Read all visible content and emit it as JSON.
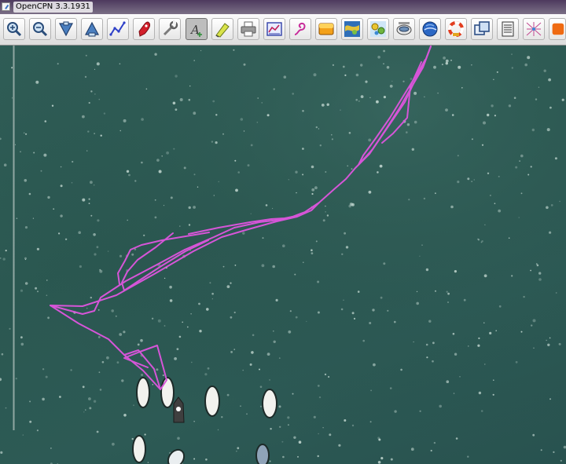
{
  "window": {
    "title": "OpenCPN 3.3.1931"
  },
  "toolbar": {
    "tools": [
      {
        "name": "zoom-in-icon"
      },
      {
        "name": "zoom-out-icon"
      },
      {
        "name": "scale-down-icon"
      },
      {
        "name": "scale-up-icon"
      },
      {
        "name": "create-route-icon"
      },
      {
        "name": "auto-follow-icon"
      },
      {
        "name": "settings-icon"
      },
      {
        "name": "text-icon",
        "active": true
      },
      {
        "name": "current-tide-icon"
      },
      {
        "name": "print-icon"
      },
      {
        "name": "route-manager-icon"
      },
      {
        "name": "track-icon"
      },
      {
        "name": "color-scheme-icon"
      },
      {
        "name": "ais-icon"
      },
      {
        "name": "weather-icon"
      },
      {
        "name": "tides-icon"
      },
      {
        "name": "google-earth-icon"
      },
      {
        "name": "mob-icon"
      },
      {
        "name": "chart-outlines-icon"
      },
      {
        "name": "log-icon"
      },
      {
        "name": "dashboard-icon"
      },
      {
        "name": "plugin-icon"
      }
    ]
  },
  "colors": {
    "track": "#d655d8",
    "water": "#2f5c55",
    "boat_hull": "#f2f2ee"
  }
}
